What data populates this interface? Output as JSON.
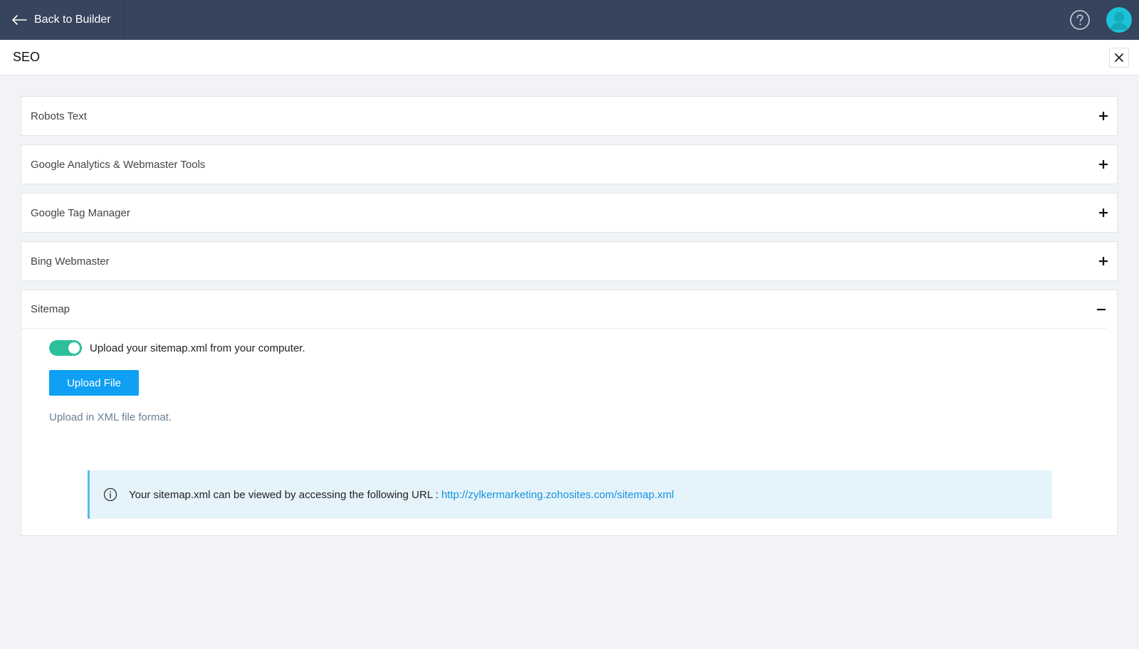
{
  "topbar": {
    "back_label": "Back to Builder",
    "help_icon": "help-circle-icon",
    "avatar_icon": "user-avatar-icon",
    "background": "#36445d",
    "avatar_color": "#1cc3d8"
  },
  "header": {
    "title": "SEO",
    "close_icon": "close-icon"
  },
  "panels": [
    {
      "title": "Robots Text",
      "expanded": false
    },
    {
      "title": "Google Analytics & Webmaster Tools",
      "expanded": false
    },
    {
      "title": "Google Tag Manager",
      "expanded": false
    },
    {
      "title": "Bing Webmaster",
      "expanded": false
    },
    {
      "title": "Sitemap",
      "expanded": true
    }
  ],
  "sitemap": {
    "toggle_on": true,
    "toggle_label": "Upload your sitemap.xml from your computer.",
    "upload_button": "Upload File",
    "hint": "Upload in XML file format.",
    "info_text": "Your sitemap.xml can be viewed by accessing the following URL :",
    "info_link": "http://zylkermarketing.zohosites.com/sitemap.xml",
    "toggle_color": "#2bbf9d",
    "button_color": "#0f9ff3"
  }
}
